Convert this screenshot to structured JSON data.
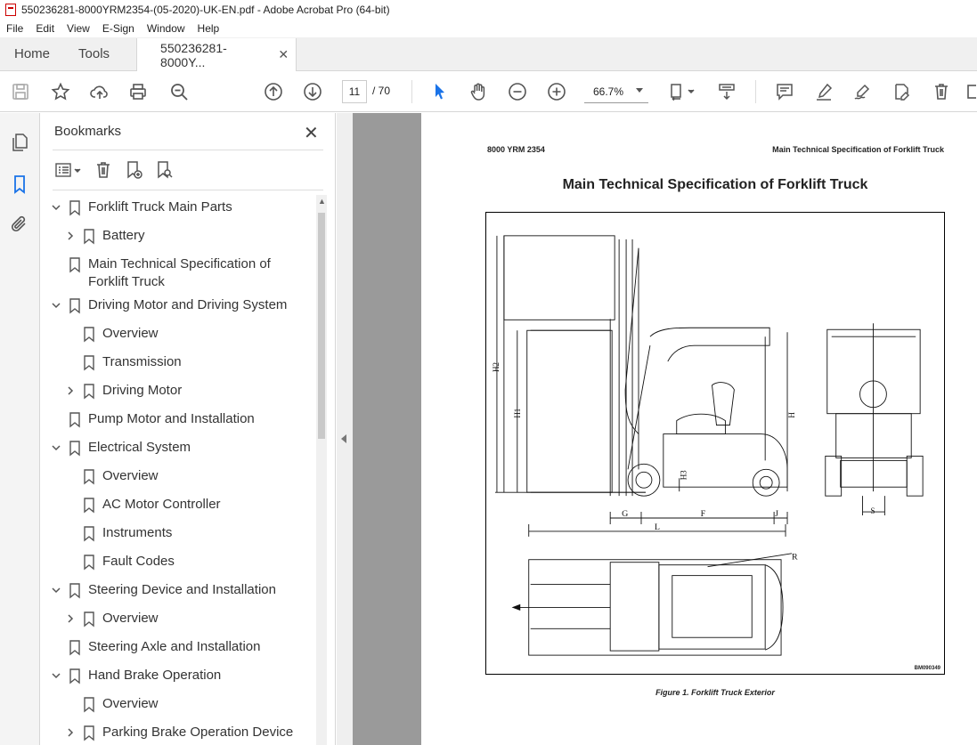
{
  "window": {
    "title": "550236281-8000YRM2354-(05-2020)-UK-EN.pdf - Adobe Acrobat Pro (64-bit)"
  },
  "menu": [
    "File",
    "Edit",
    "View",
    "E-Sign",
    "Window",
    "Help"
  ],
  "tabs": {
    "home": "Home",
    "tools": "Tools",
    "doc": "550236281-8000Y..."
  },
  "toolbar": {
    "page_current": "11",
    "page_total": "/ 70",
    "zoom": "66.7%"
  },
  "bookmarks": {
    "title": "Bookmarks",
    "items": [
      {
        "label": "Forklift Truck Main Parts",
        "level": 0,
        "expander": "down"
      },
      {
        "label": "Battery",
        "level": 1,
        "expander": "right"
      },
      {
        "label": "Main Technical Specification of Forklift Truck",
        "level": 0,
        "expander": "none"
      },
      {
        "label": "Driving Motor and Driving System",
        "level": 0,
        "expander": "down"
      },
      {
        "label": "Overview",
        "level": 1,
        "expander": "none"
      },
      {
        "label": "Transmission",
        "level": 1,
        "expander": "none"
      },
      {
        "label": "Driving Motor",
        "level": 1,
        "expander": "right"
      },
      {
        "label": "Pump Motor and Installation",
        "level": 0,
        "expander": "none"
      },
      {
        "label": "Electrical System",
        "level": 0,
        "expander": "down"
      },
      {
        "label": "Overview",
        "level": 1,
        "expander": "none"
      },
      {
        "label": "AC Motor Controller",
        "level": 1,
        "expander": "none"
      },
      {
        "label": "Instruments",
        "level": 1,
        "expander": "none"
      },
      {
        "label": "Fault Codes",
        "level": 1,
        "expander": "none"
      },
      {
        "label": "Steering Device and Installation",
        "level": 0,
        "expander": "down"
      },
      {
        "label": "Overview",
        "level": 1,
        "expander": "right"
      },
      {
        "label": "Steering Axle and Installation",
        "level": 0,
        "expander": "none"
      },
      {
        "label": "Hand Brake Operation",
        "level": 0,
        "expander": "down"
      },
      {
        "label": "Overview",
        "level": 1,
        "expander": "none"
      },
      {
        "label": "Parking Brake Operation Device",
        "level": 1,
        "expander": "right"
      }
    ]
  },
  "page": {
    "header_left": "8000 YRM 2354",
    "header_right": "Main Technical Specification of Forklift Truck",
    "title": "Main Technical Specification of Forklift Truck",
    "figure_code": "BM090349",
    "caption": "Figure 1. Forklift Truck Exterior",
    "dim_labels": {
      "h2": "H2",
      "h1": "H1",
      "h": "H",
      "h3": "H3",
      "g": "G",
      "f": "F",
      "j": "J",
      "l": "L",
      "s": "S",
      "r": "R"
    }
  }
}
